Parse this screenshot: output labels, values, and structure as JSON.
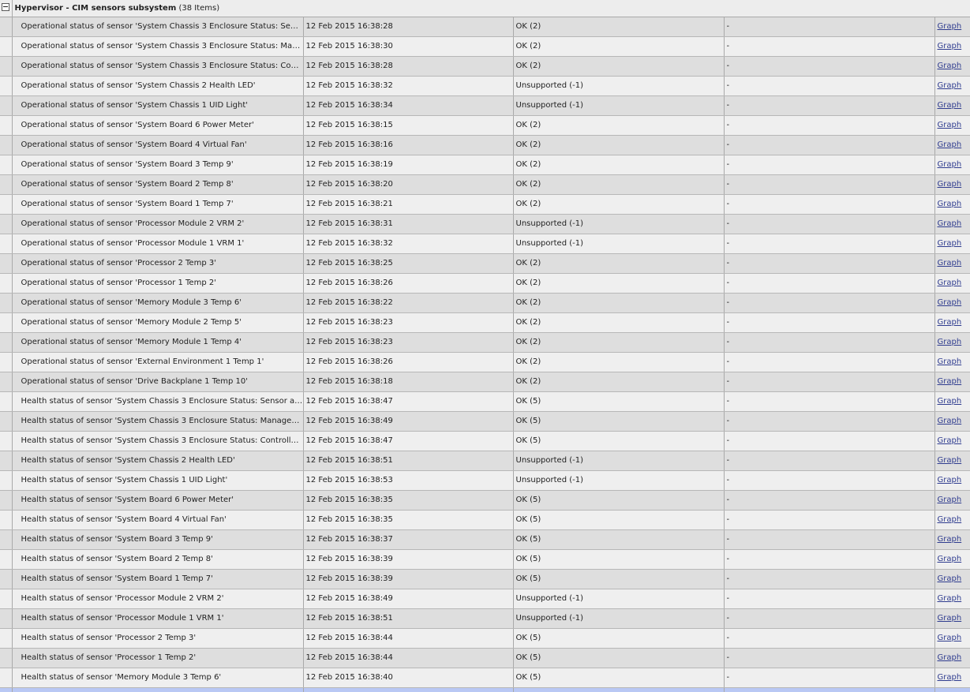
{
  "group": {
    "title": "Hypervisor - CIM sensors subsystem",
    "count": "(38 Items)"
  },
  "link_label": "Graph",
  "rows": [
    {
      "name": "Operational status of sensor 'System Chassis 3 Enclosure Status: Sensor access degraded or unavailable'",
      "time": "12 Feb 2015 16:38:28",
      "value": "OK (2)",
      "change": "-"
    },
    {
      "name": "Operational status of sensor 'System Chassis 3 Enclosure Status: Management Subsystem Health'",
      "time": "12 Feb 2015 16:38:30",
      "value": "OK (2)",
      "change": "-"
    },
    {
      "name": "Operational status of sensor 'System Chassis 3 Enclosure Status: Controller access degraded or unavailable'",
      "time": "12 Feb 2015 16:38:28",
      "value": "OK (2)",
      "change": "-"
    },
    {
      "name": "Operational status of sensor 'System Chassis 2 Health LED'",
      "time": "12 Feb 2015 16:38:32",
      "value": "Unsupported (-1)",
      "change": "-"
    },
    {
      "name": "Operational status of sensor 'System Chassis 1 UID Light'",
      "time": "12 Feb 2015 16:38:34",
      "value": "Unsupported (-1)",
      "change": "-"
    },
    {
      "name": "Operational status of sensor 'System Board 6 Power Meter'",
      "time": "12 Feb 2015 16:38:15",
      "value": "OK (2)",
      "change": "-"
    },
    {
      "name": "Operational status of sensor 'System Board 4 Virtual Fan'",
      "time": "12 Feb 2015 16:38:16",
      "value": "OK (2)",
      "change": "-"
    },
    {
      "name": "Operational status of sensor 'System Board 3 Temp 9'",
      "time": "12 Feb 2015 16:38:19",
      "value": "OK (2)",
      "change": "-"
    },
    {
      "name": "Operational status of sensor 'System Board 2 Temp 8'",
      "time": "12 Feb 2015 16:38:20",
      "value": "OK (2)",
      "change": "-"
    },
    {
      "name": "Operational status of sensor 'System Board 1 Temp 7'",
      "time": "12 Feb 2015 16:38:21",
      "value": "OK (2)",
      "change": "-"
    },
    {
      "name": "Operational status of sensor 'Processor Module 2 VRM 2'",
      "time": "12 Feb 2015 16:38:31",
      "value": "Unsupported (-1)",
      "change": "-"
    },
    {
      "name": "Operational status of sensor 'Processor Module 1 VRM 1'",
      "time": "12 Feb 2015 16:38:32",
      "value": "Unsupported (-1)",
      "change": "-"
    },
    {
      "name": "Operational status of sensor 'Processor 2 Temp 3'",
      "time": "12 Feb 2015 16:38:25",
      "value": "OK (2)",
      "change": "-"
    },
    {
      "name": "Operational status of sensor 'Processor 1 Temp 2'",
      "time": "12 Feb 2015 16:38:26",
      "value": "OK (2)",
      "change": "-"
    },
    {
      "name": "Operational status of sensor 'Memory Module 3 Temp 6'",
      "time": "12 Feb 2015 16:38:22",
      "value": "OK (2)",
      "change": "-"
    },
    {
      "name": "Operational status of sensor 'Memory Module 2 Temp 5'",
      "time": "12 Feb 2015 16:38:23",
      "value": "OK (2)",
      "change": "-"
    },
    {
      "name": "Operational status of sensor 'Memory Module 1 Temp 4'",
      "time": "12 Feb 2015 16:38:23",
      "value": "OK (2)",
      "change": "-"
    },
    {
      "name": "Operational status of sensor 'External Environment 1 Temp 1'",
      "time": "12 Feb 2015 16:38:26",
      "value": "OK (2)",
      "change": "-"
    },
    {
      "name": "Operational status of sensor 'Drive Backplane 1 Temp 10'",
      "time": "12 Feb 2015 16:38:18",
      "value": "OK (2)",
      "change": "-"
    },
    {
      "name": "Health status of sensor 'System Chassis 3 Enclosure Status: Sensor access degraded or unavailable'",
      "time": "12 Feb 2015 16:38:47",
      "value": "OK (5)",
      "change": "-"
    },
    {
      "name": "Health status of sensor 'System Chassis 3 Enclosure Status: Management Subsystem Health'",
      "time": "12 Feb 2015 16:38:49",
      "value": "OK (5)",
      "change": "-"
    },
    {
      "name": "Health status of sensor 'System Chassis 3 Enclosure Status: Controller access degraded or unavailable'",
      "time": "12 Feb 2015 16:38:47",
      "value": "OK (5)",
      "change": "-"
    },
    {
      "name": "Health status of sensor 'System Chassis 2 Health LED'",
      "time": "12 Feb 2015 16:38:51",
      "value": "Unsupported (-1)",
      "change": "-"
    },
    {
      "name": "Health status of sensor 'System Chassis 1 UID Light'",
      "time": "12 Feb 2015 16:38:53",
      "value": "Unsupported (-1)",
      "change": "-"
    },
    {
      "name": "Health status of sensor 'System Board 6 Power Meter'",
      "time": "12 Feb 2015 16:38:35",
      "value": "OK (5)",
      "change": "-"
    },
    {
      "name": "Health status of sensor 'System Board 4 Virtual Fan'",
      "time": "12 Feb 2015 16:38:35",
      "value": "OK (5)",
      "change": "-"
    },
    {
      "name": "Health status of sensor 'System Board 3 Temp 9'",
      "time": "12 Feb 2015 16:38:37",
      "value": "OK (5)",
      "change": "-"
    },
    {
      "name": "Health status of sensor 'System Board 2 Temp 8'",
      "time": "12 Feb 2015 16:38:39",
      "value": "OK (5)",
      "change": "-"
    },
    {
      "name": "Health status of sensor 'System Board 1 Temp 7'",
      "time": "12 Feb 2015 16:38:39",
      "value": "OK (5)",
      "change": "-"
    },
    {
      "name": "Health status of sensor 'Processor Module 2 VRM 2'",
      "time": "12 Feb 2015 16:38:49",
      "value": "Unsupported (-1)",
      "change": "-"
    },
    {
      "name": "Health status of sensor 'Processor Module 1 VRM 1'",
      "time": "12 Feb 2015 16:38:51",
      "value": "Unsupported (-1)",
      "change": "-"
    },
    {
      "name": "Health status of sensor 'Processor 2 Temp 3'",
      "time": "12 Feb 2015 16:38:44",
      "value": "OK (5)",
      "change": "-"
    },
    {
      "name": "Health status of sensor 'Processor 1 Temp 2'",
      "time": "12 Feb 2015 16:38:44",
      "value": "OK (5)",
      "change": "-"
    },
    {
      "name": "Health status of sensor 'Memory Module 3 Temp 6'",
      "time": "12 Feb 2015 16:38:40",
      "value": "OK (5)",
      "change": "-"
    }
  ]
}
